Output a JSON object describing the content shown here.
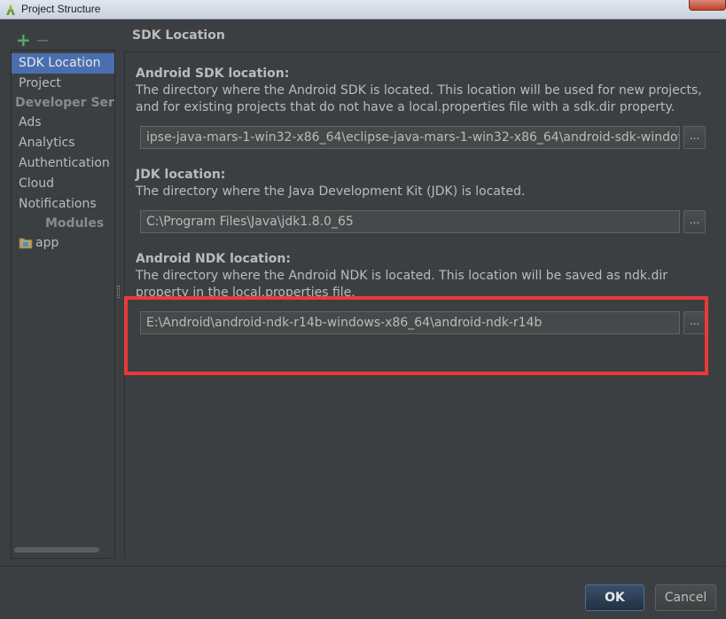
{
  "window": {
    "title": "Project Structure"
  },
  "sidebar": {
    "add_icon": "plus-icon",
    "remove_icon": "minus-icon",
    "items": [
      {
        "label": "SDK Location",
        "selected": true
      },
      {
        "label": "Project",
        "selected": false
      }
    ],
    "developer_services_heading": "Developer Servic",
    "developer_services": [
      {
        "label": "Ads"
      },
      {
        "label": "Analytics"
      },
      {
        "label": "Authentication"
      },
      {
        "label": "Cloud"
      },
      {
        "label": "Notifications"
      }
    ],
    "modules_heading": "Modules",
    "modules": [
      {
        "label": "app",
        "icon": "module-folder-icon"
      }
    ]
  },
  "panel": {
    "title": "SDK Location",
    "android_sdk": {
      "heading": "Android SDK location:",
      "description": "The directory where the Android SDK is located. This location will be used for new projects, and for existing projects that do not have a local.properties file with a sdk.dir property.",
      "value": "ipse-java-mars-1-win32-x86_64\\eclipse-java-mars-1-win32-x86_64\\android-sdk-windows",
      "browse_label": "..."
    },
    "jdk": {
      "heading": "JDK location:",
      "description": "The directory where the Java Development Kit (JDK) is located.",
      "value": "C:\\Program Files\\Java\\jdk1.8.0_65",
      "browse_label": "..."
    },
    "android_ndk": {
      "heading": "Android NDK location:",
      "description": "The directory where the Android NDK is located. This location will be saved as ndk.dir property in the local.properties file.",
      "value": "E:\\Android\\android-ndk-r14b-windows-x86_64\\android-ndk-r14b",
      "browse_label": "..."
    }
  },
  "footer": {
    "ok_label": "OK",
    "cancel_label": "Cancel"
  },
  "colors": {
    "background": "#3c3f41",
    "selection": "#4b6eaf",
    "highlight_annotation": "#e83a3a",
    "add_icon": "#59a869"
  }
}
